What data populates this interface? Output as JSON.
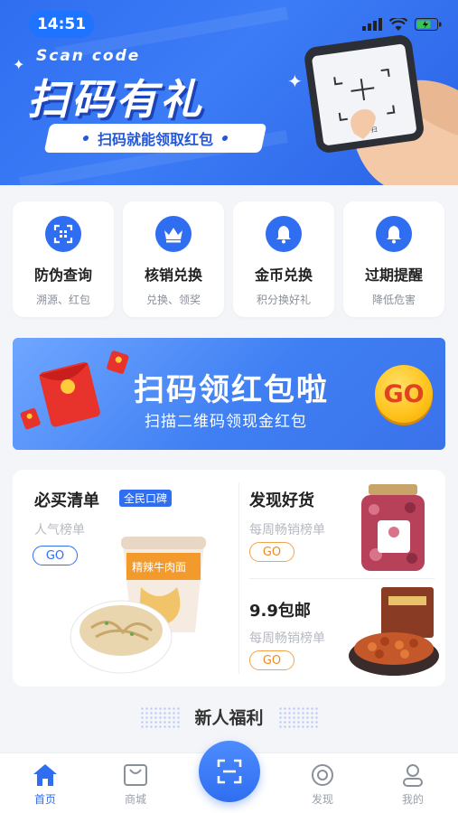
{
  "status": {
    "time": "14:51"
  },
  "hero": {
    "scan_code": "Scan code",
    "title": "扫码有礼",
    "subtitle": "扫码就能领取红包",
    "phone_caption": "扫一扫"
  },
  "quick_actions": [
    {
      "title": "防伪查询",
      "subtitle": "溯源、红包",
      "icon": "qr-code-icon"
    },
    {
      "title": "核销兑换",
      "subtitle": "兑换、领奖",
      "icon": "crown-icon"
    },
    {
      "title": "金币兑换",
      "subtitle": "积分换好礼",
      "icon": "bell-icon"
    },
    {
      "title": "过期提醒",
      "subtitle": "降低危害",
      "icon": "bell-icon"
    }
  ],
  "banner": {
    "title": "扫码领红包啦",
    "subtitle": "扫描二维码领现金红包",
    "go": "GO"
  },
  "products": {
    "must_buy": {
      "title": "必买清单",
      "badge": "全民口碑",
      "subtitle": "人气榜单",
      "go": "GO",
      "cup_label": "精辣牛肉面"
    },
    "discover": {
      "title": "发现好货",
      "subtitle": "每周畅销榜单",
      "go": "GO"
    },
    "free_ship": {
      "title": "9.9包邮",
      "subtitle": "每周畅销榜单",
      "go": "GO"
    }
  },
  "section": {
    "title": "新人福利"
  },
  "tabbar": {
    "items": [
      {
        "label": "首页",
        "icon": "home-icon",
        "active": true
      },
      {
        "label": "商城",
        "icon": "shopping-bag-icon",
        "active": false
      },
      {
        "label": "发现",
        "icon": "discover-icon",
        "active": false
      },
      {
        "label": "我的",
        "icon": "profile-icon",
        "active": false
      }
    ]
  },
  "colors": {
    "primary": "#2f6ef0",
    "accent_orange": "#f08a1e",
    "go_yellow": "#ffc21a"
  }
}
